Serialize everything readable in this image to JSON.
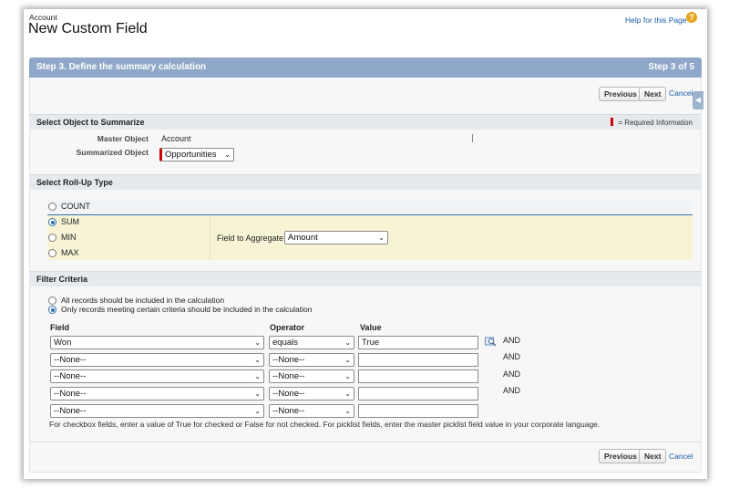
{
  "header": {
    "object_label": "Account",
    "title": "New Custom Field",
    "help_link": "Help for this Page",
    "help_icon": "?"
  },
  "step": {
    "title": "Step 3. Define the summary calculation",
    "counter": "Step 3 of 5"
  },
  "buttons": {
    "previous": "Previous",
    "next": "Next",
    "cancel": "Cancel"
  },
  "side_tab_icon": "◀",
  "object_section": {
    "heading": "Select Object to Summarize",
    "required_note": "= Required Information",
    "master_object_label": "Master Object",
    "master_object_value": "Account",
    "summarized_object_label": "Summarized Object",
    "summarized_object_value": "Opportunities"
  },
  "rollup_section": {
    "heading": "Select Roll-Up Type",
    "options": [
      "COUNT",
      "SUM",
      "MIN",
      "MAX"
    ],
    "selected": "SUM",
    "field_label": "Field to Aggregate",
    "field_value": "Amount"
  },
  "filter_section": {
    "heading": "Filter Criteria",
    "option_all": "All records should be included in the calculation",
    "option_some": "Only records meeting certain criteria should be included in the calculation",
    "selected": "option_some",
    "columns": {
      "field": "Field",
      "operator": "Operator",
      "value": "Value"
    },
    "rows": [
      {
        "field": "Won",
        "operator": "equals",
        "value": "True",
        "conj": "AND"
      },
      {
        "field": "--None--",
        "operator": "--None--",
        "value": "",
        "conj": "AND"
      },
      {
        "field": "--None--",
        "operator": "--None--",
        "value": "",
        "conj": "AND"
      },
      {
        "field": "--None--",
        "operator": "--None--",
        "value": "",
        "conj": "AND"
      },
      {
        "field": "--None--",
        "operator": "--None--",
        "value": "",
        "conj": ""
      }
    ],
    "hint": "For checkbox fields, enter a value of True for checked or False for not checked. For picklist fields, enter the master picklist field value in your corporate language."
  },
  "colors": {
    "step_bar": "#8fa8c9",
    "link": "#1a5da6",
    "required": "#cc0000",
    "rollup_panel": "#f7f4d6"
  }
}
